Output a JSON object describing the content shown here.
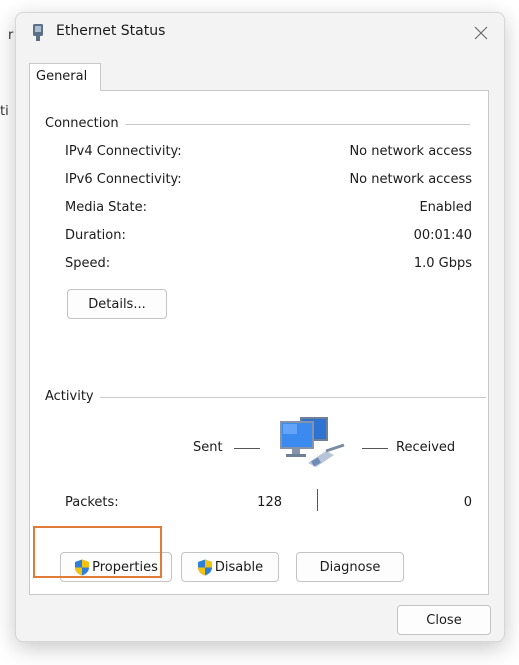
{
  "background": {
    "fragment_1": "r",
    "fragment_2": "ti"
  },
  "window": {
    "title": "Ethernet Status",
    "icon": "network-adapter-icon",
    "close_icon": "close-icon"
  },
  "tabs": [
    {
      "label": "General",
      "selected": true
    }
  ],
  "connection": {
    "group_label": "Connection",
    "rows": [
      {
        "label": "IPv4 Connectivity:",
        "value": "No network access"
      },
      {
        "label": "IPv6 Connectivity:",
        "value": "No network access"
      },
      {
        "label": "Media State:",
        "value": "Enabled"
      },
      {
        "label": "Duration:",
        "value": "00:01:40"
      },
      {
        "label": "Speed:",
        "value": "1.0 Gbps"
      }
    ],
    "details_button": "Details..."
  },
  "activity": {
    "group_label": "Activity",
    "sent_label": "Sent",
    "received_label": "Received",
    "packets_label": "Packets:",
    "packets_sent": "128",
    "packets_received": "0",
    "icon": "network-computers-icon"
  },
  "buttons": {
    "properties": "Properties",
    "disable": "Disable",
    "diagnose": "Diagnose",
    "close": "Close"
  },
  "colors": {
    "highlight": "#e07b3a",
    "shield_blue": "#2f7fd8",
    "shield_yellow": "#f3c20d"
  }
}
